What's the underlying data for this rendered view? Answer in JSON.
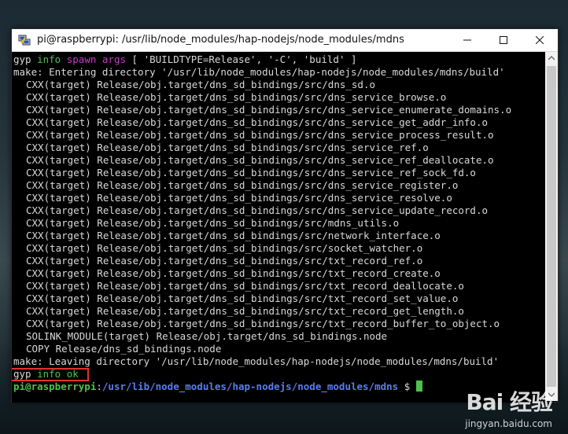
{
  "window": {
    "title": "pi@raspberrypi: /usr/lib/node_modules/hap-nodejs/node_modules/mdns"
  },
  "terminal": {
    "line01": {
      "a": "gyp ",
      "b": "info",
      "c": " ",
      "d": "spawn args",
      "e": " [ 'BUILDTYPE=Release', '-C', 'build' ]"
    },
    "line02": "make: Entering directory '/usr/lib/node_modules/hap-nodejs/node_modules/mdns/build'",
    "lines": [
      "CXX(target) Release/obj.target/dns_sd_bindings/src/dns_sd.o",
      "CXX(target) Release/obj.target/dns_sd_bindings/src/dns_service_browse.o",
      "CXX(target) Release/obj.target/dns_sd_bindings/src/dns_service_enumerate_domains.o",
      "CXX(target) Release/obj.target/dns_sd_bindings/src/dns_service_get_addr_info.o",
      "CXX(target) Release/obj.target/dns_sd_bindings/src/dns_service_process_result.o",
      "CXX(target) Release/obj.target/dns_sd_bindings/src/dns_service_ref.o",
      "CXX(target) Release/obj.target/dns_sd_bindings/src/dns_service_ref_deallocate.o",
      "CXX(target) Release/obj.target/dns_sd_bindings/src/dns_service_ref_sock_fd.o",
      "CXX(target) Release/obj.target/dns_sd_bindings/src/dns_service_register.o",
      "CXX(target) Release/obj.target/dns_sd_bindings/src/dns_service_resolve.o",
      "CXX(target) Release/obj.target/dns_sd_bindings/src/dns_service_update_record.o",
      "CXX(target) Release/obj.target/dns_sd_bindings/src/mdns_utils.o",
      "CXX(target) Release/obj.target/dns_sd_bindings/src/network_interface.o",
      "CXX(target) Release/obj.target/dns_sd_bindings/src/socket_watcher.o",
      "CXX(target) Release/obj.target/dns_sd_bindings/src/txt_record_ref.o",
      "CXX(target) Release/obj.target/dns_sd_bindings/src/txt_record_create.o",
      "CXX(target) Release/obj.target/dns_sd_bindings/src/txt_record_deallocate.o",
      "CXX(target) Release/obj.target/dns_sd_bindings/src/txt_record_set_value.o",
      "CXX(target) Release/obj.target/dns_sd_bindings/src/txt_record_get_length.o",
      "CXX(target) Release/obj.target/dns_sd_bindings/src/txt_record_buffer_to_object.o",
      "SOLINK_MODULE(target) Release/obj.target/dns_sd_bindings.node",
      "COPY Release/dns_sd_bindings.node"
    ],
    "leave": "make: Leaving directory '/usr/lib/node_modules/hap-nodejs/node_modules/mdns/build'",
    "ok": {
      "a": "gyp ",
      "b": "info",
      "c": " ",
      "d": "ok"
    },
    "prompt": {
      "user": "pi@raspberrypi",
      "sep": ":",
      "path": "/usr/lib/node_modules/hap-nodejs/node_modules/mdns",
      "sign": " $ "
    }
  },
  "colors": {
    "info": "#4ec24e",
    "spawn": "#c83bc8",
    "prompt": "#4ec24e",
    "path": "#5b7cf0",
    "highlight": "#e0332f"
  },
  "icons": {
    "app": "putty-icon",
    "minimize": "minimize-icon",
    "maximize": "maximize-icon",
    "close": "close-icon"
  },
  "watermark": {
    "logo": "Bai 经验",
    "url": "jingyan.baidu.com"
  }
}
